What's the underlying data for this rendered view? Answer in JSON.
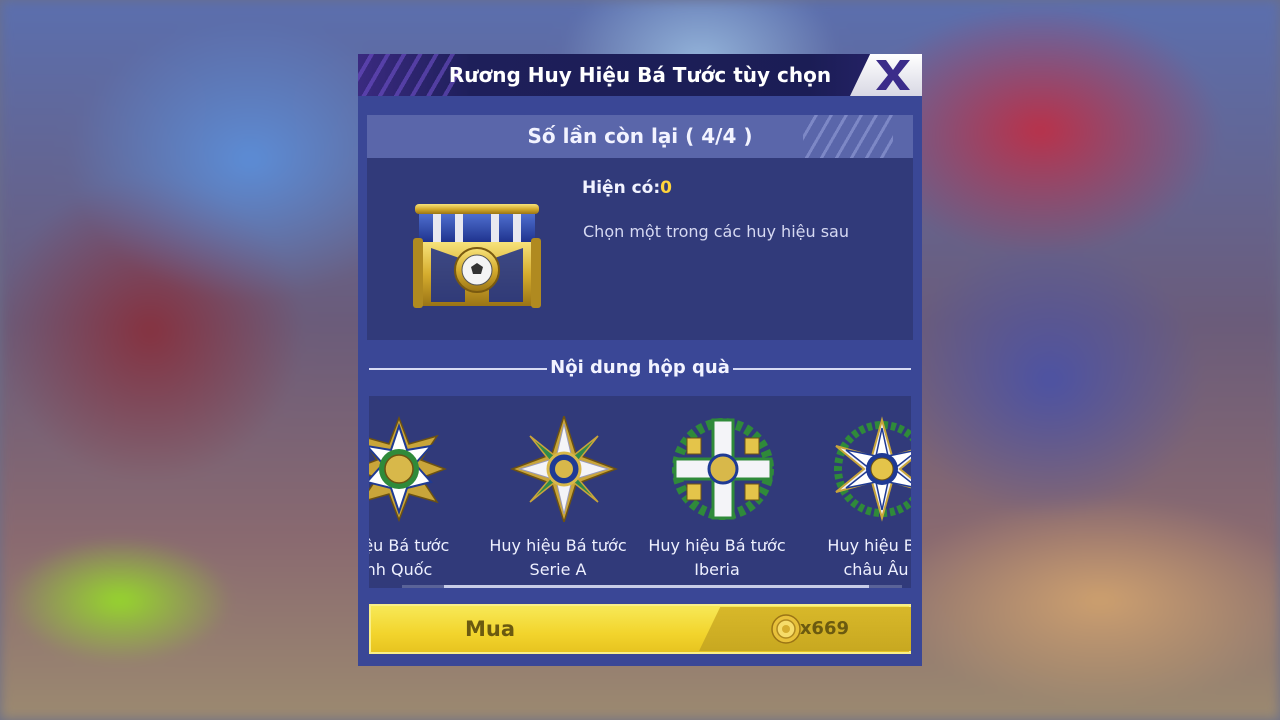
{
  "dialog": {
    "title": "Rương Huy Hiệu Bá Tước tùy chọn",
    "close_icon": "close-x-icon"
  },
  "remaining": {
    "text": "Số lần còn lại ( 4/4 )"
  },
  "info": {
    "have_label": "Hiện có:",
    "have_count": "0",
    "description": "Chọn một trong các huy hiệu sau",
    "chest_icon": "gold-blue-chest-icon"
  },
  "contents": {
    "section_title": "Nội dung hộp quà",
    "items": [
      {
        "name_line1": "hiệu Bá tước",
        "name_line2": "nh Quốc",
        "icon": "anh-quoc-badge-icon"
      },
      {
        "name_line1": "Huy hiệu Bá tước",
        "name_line2": "Serie A",
        "icon": "serie-a-badge-icon"
      },
      {
        "name_line1": "Huy hiệu Bá tước",
        "name_line2": "Iberia",
        "icon": "iberia-badge-icon"
      },
      {
        "name_line1": "Huy hiệu Bá ",
        "name_line2": "châu Âu",
        "icon": "chau-au-badge-icon"
      }
    ]
  },
  "buy": {
    "label": "Mua",
    "price": "x669",
    "coin_icon": "gold-coin-icon"
  },
  "colors": {
    "dialog_bg": "#3a4796",
    "panel_bg": "#313a7a",
    "button_yellow": "#f2d42c",
    "count_highlight": "#ffd43b"
  }
}
